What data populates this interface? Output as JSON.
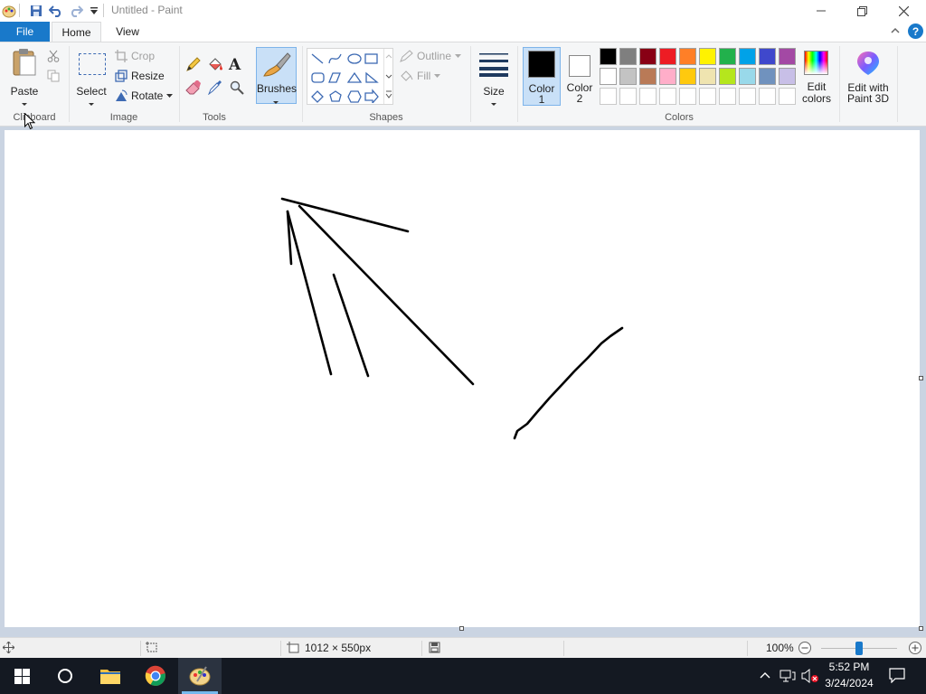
{
  "window": {
    "title": "Untitled - Paint",
    "controls": [
      "minimize",
      "restore",
      "close"
    ]
  },
  "quick_access": [
    "save-icon",
    "undo-icon",
    "redo-icon",
    "customize-dropdown-icon"
  ],
  "tabs": [
    {
      "label": "File"
    },
    {
      "label": "Home"
    },
    {
      "label": "View"
    }
  ],
  "ribbon": {
    "clipboard": {
      "paste": "Paste",
      "group": "Clipboard"
    },
    "image": {
      "select": "Select",
      "crop": "Crop",
      "resize": "Resize",
      "rotate": "Rotate",
      "group": "Image"
    },
    "tools": {
      "group": "Tools"
    },
    "brushes": {
      "label": "Brushes"
    },
    "shapes": {
      "outline": "Outline",
      "fill": "Fill",
      "group": "Shapes"
    },
    "size": {
      "label": "Size"
    },
    "colors": {
      "color1": "Color",
      "color1_num": "1",
      "color2": "Color",
      "color2_num": "2",
      "edit_colors": "Edit colors",
      "edit_with": "Edit with",
      "paint3d": "Paint 3D",
      "group": "Colors",
      "palette_row1": [
        "#000000",
        "#7f7f7f",
        "#880015",
        "#ed1c24",
        "#ff7f27",
        "#fff200",
        "#22b14c",
        "#00a2e8",
        "#3f48cc",
        "#a349a4"
      ],
      "palette_row2": [
        "#ffffff",
        "#c3c3c3",
        "#b97a57",
        "#ffaec9",
        "#ffc90e",
        "#efe4b0",
        "#b5e61d",
        "#99d9ea",
        "#7092be",
        "#c8bfe7"
      ],
      "palette_row3_count": 10,
      "color1_value": "#000000",
      "color2_value": "#ffffff"
    }
  },
  "status": {
    "canvas_size": "1012 × 550px",
    "zoom": "100%",
    "zoom_level": 0.5
  },
  "taskbar": {
    "time": "5:52 PM",
    "date": "3/24/2024"
  }
}
